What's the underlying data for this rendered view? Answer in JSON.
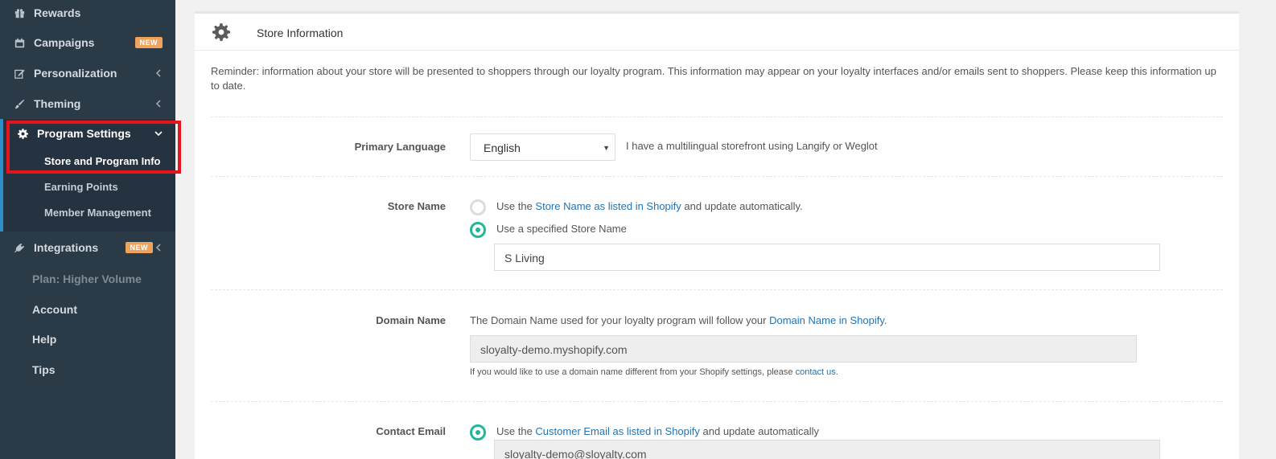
{
  "sidebar": {
    "items": [
      {
        "label": "Rewards",
        "icon": "gift-icon"
      },
      {
        "label": "Campaigns",
        "icon": "calendar-icon",
        "badge": "NEW"
      },
      {
        "label": "Personalization",
        "icon": "edit-icon"
      },
      {
        "label": "Theming",
        "icon": "brush-icon"
      },
      {
        "label": "Program Settings",
        "icon": "gear-icon"
      },
      {
        "label": "Integrations",
        "icon": "plug-icon",
        "badge": "NEW"
      }
    ],
    "sub_items": [
      "Store and Program Info",
      "Earning Points",
      "Member Management"
    ],
    "plain_items": [
      "Plan: Higher Volume",
      "Account",
      "Help",
      "Tips"
    ]
  },
  "card": {
    "title": "Store Information",
    "reminder": "Reminder: information about your store will be presented to shoppers through our loyalty program. This information may appear on your loyalty interfaces and/or emails sent to shoppers. Please keep this information up to date."
  },
  "primary_language": {
    "label": "Primary Language",
    "selected": "English",
    "link": "I have a multilingual storefront using Langify or Weglot"
  },
  "store_name": {
    "label": "Store Name",
    "option1_prefix": "Use the ",
    "option1_link": "Store Name as listed in Shopify",
    "option1_suffix": " and update automatically.",
    "option2": "Use a specified Store Name",
    "value": "S Living"
  },
  "domain_name": {
    "label": "Domain Name",
    "text_prefix": "The Domain Name used for your loyalty program will follow your ",
    "text_link": "Domain Name in Shopify",
    "text_suffix": ".",
    "value": "sloyalty-demo.myshopify.com",
    "help_prefix": "If you would like to use a domain name different from your Shopify settings, please ",
    "help_link": "contact us",
    "help_suffix": "."
  },
  "contact_email": {
    "label": "Contact Email",
    "option_prefix": "Use the ",
    "option_link": "Customer Email as listed in Shopify",
    "option_suffix": " and update automatically",
    "value": "sloyalty-demo@sloyalty.com"
  },
  "colors": {
    "accent": "#1fb89a",
    "link": "#2573b0",
    "highlight": "#e8141c",
    "badge": "#f0a35c",
    "sidebar": "#2b3a47"
  }
}
